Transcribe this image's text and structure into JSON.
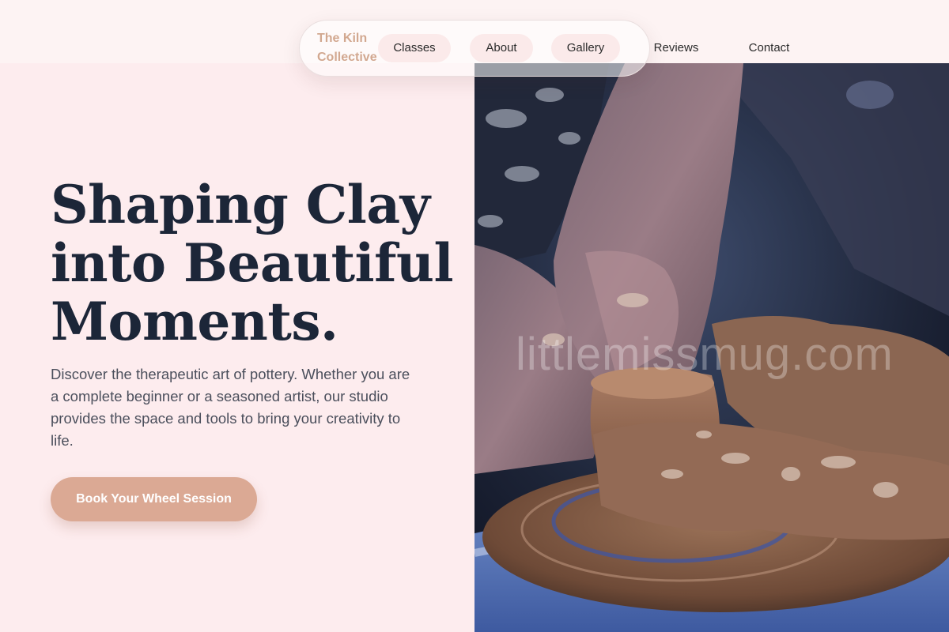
{
  "header": {
    "brand": "The Kiln Collective",
    "nav": [
      {
        "label": "Classes"
      },
      {
        "label": "About"
      },
      {
        "label": "Gallery"
      },
      {
        "label": "Reviews"
      },
      {
        "label": "Contact"
      }
    ]
  },
  "hero": {
    "headline_lines": [
      "Shaping Clay",
      "into Beautiful",
      "Moments."
    ],
    "description": "Discover the therapeutic art of pottery. Whether you are a complete beginner or a seasoned artist, our studio provides the space and tools to bring your creativity to life.",
    "cta_label": "Book Your Wheel Session"
  },
  "image": {
    "watermark": "littlemissmug.com"
  },
  "colors": {
    "accent": "#dba994",
    "heading": "#1c2638",
    "brand": "#d2a890",
    "background": "#fdecee"
  }
}
